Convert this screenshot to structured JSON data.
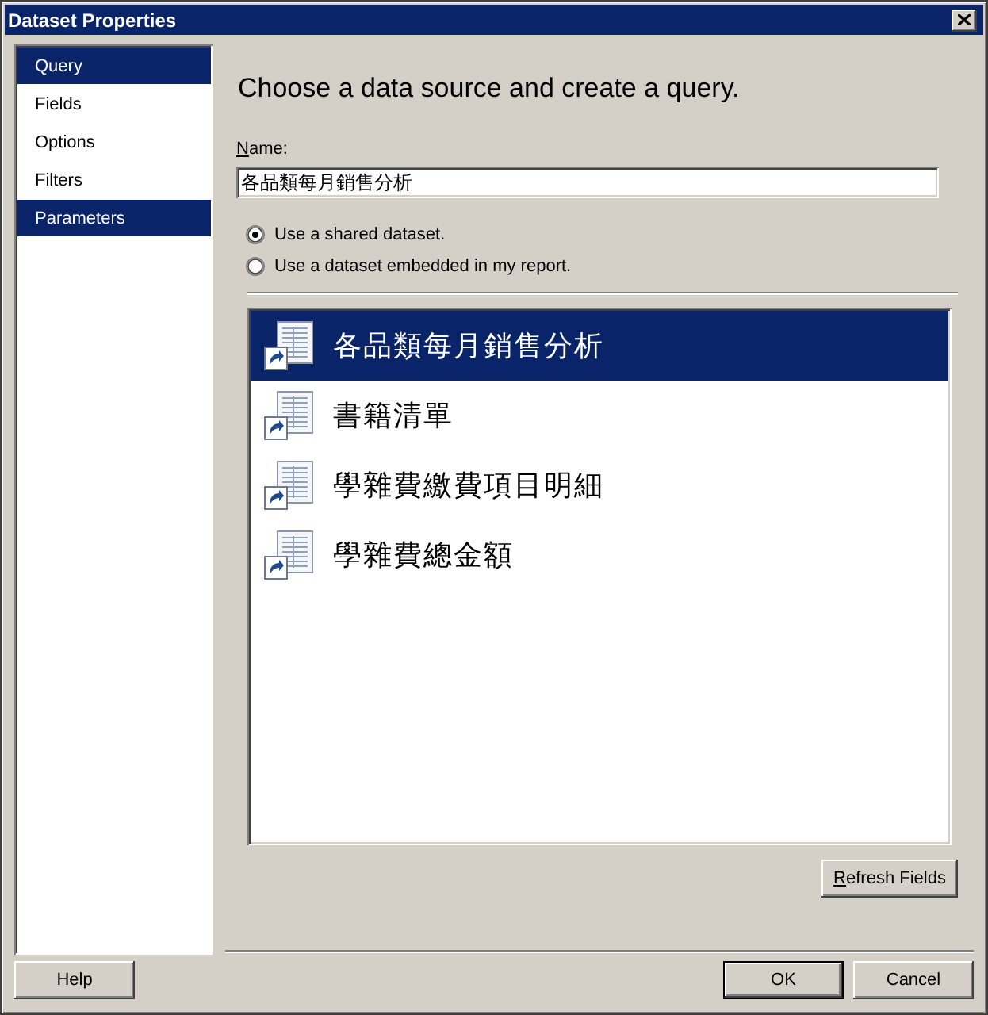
{
  "window": {
    "title": "Dataset Properties"
  },
  "sidebar": {
    "items": [
      {
        "label": "Query",
        "selected": true
      },
      {
        "label": "Fields",
        "selected": false
      },
      {
        "label": "Options",
        "selected": false
      },
      {
        "label": "Filters",
        "selected": false
      },
      {
        "label": "Parameters",
        "selected": true
      }
    ]
  },
  "heading": "Choose a data source and create a query.",
  "name_field": {
    "label": "Name:",
    "access_key_underlined": true,
    "value": "各品類每月銷售分析"
  },
  "source_options": [
    {
      "label": "Use a shared dataset.",
      "selected": true
    },
    {
      "label": "Use a dataset embedded in my report.",
      "selected": false
    }
  ],
  "datasets": [
    {
      "name": "各品類每月銷售分析",
      "selected": true
    },
    {
      "name": "書籍清單",
      "selected": false
    },
    {
      "name": "學雜費繳費項目明細",
      "selected": false
    },
    {
      "name": "學雜費總金額",
      "selected": false
    }
  ],
  "refresh_button": {
    "label": "Refresh Fields",
    "access_key_underlined": true
  },
  "footer": {
    "left_buttons": [
      {
        "label": "Help",
        "default": false
      }
    ],
    "right_buttons": [
      {
        "label": "OK",
        "default": true
      },
      {
        "label": "Cancel",
        "default": false
      }
    ]
  }
}
